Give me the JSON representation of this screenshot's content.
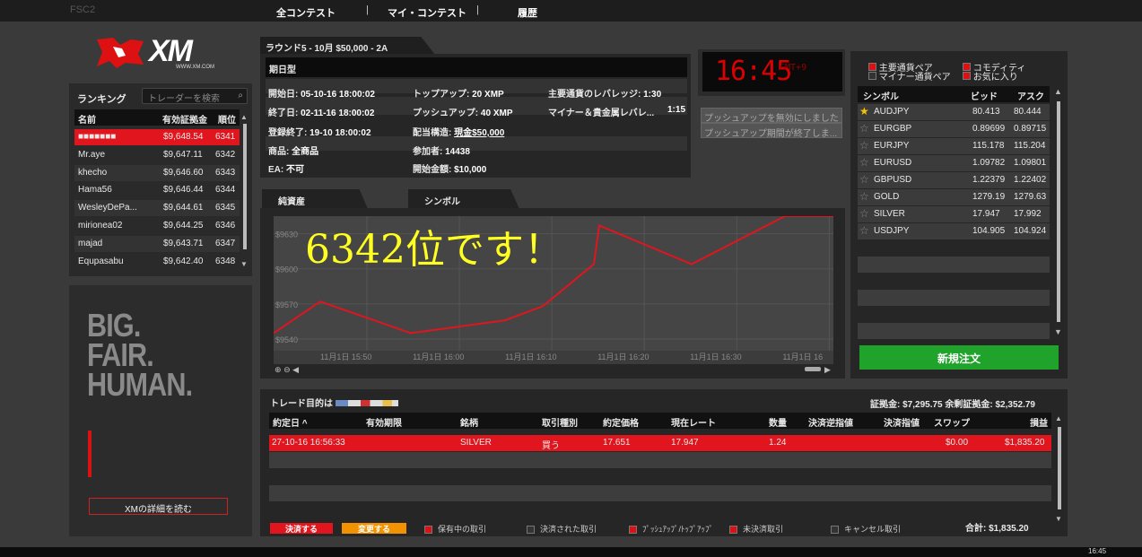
{
  "topnav": {
    "brand_faint": "FSC2",
    "all_contests": "全コンテスト",
    "sep": "|",
    "my_contests": "マイ・コンテスト",
    "history": "履歴"
  },
  "logo": {
    "text": "XM",
    "url": "WWW.XM.COM"
  },
  "ranking": {
    "title": "ランキング",
    "search_placeholder": "トレーダーを検索",
    "columns": [
      "名前",
      "有効証拠金",
      "順位"
    ],
    "rows": [
      {
        "name": "■■■■■■■",
        "equity": "$9,648.54",
        "rank": "6341"
      },
      {
        "name": "Mr.aye",
        "equity": "$9,647.11",
        "rank": "6342"
      },
      {
        "name": "khecho",
        "equity": "$9,646.60",
        "rank": "6343"
      },
      {
        "name": "Hama56",
        "equity": "$9,646.44",
        "rank": "6344"
      },
      {
        "name": "WesleyDePa...",
        "equity": "$9,644.61",
        "rank": "6345"
      },
      {
        "name": "mirionea02",
        "equity": "$9,644.25",
        "rank": "6346"
      },
      {
        "name": "majad",
        "equity": "$9,643.71",
        "rank": "6347"
      },
      {
        "name": "Equpasabu",
        "equity": "$9,642.40",
        "rank": "6348"
      }
    ]
  },
  "promo": {
    "line1": "BIG.",
    "line2": "FAIR.",
    "line3": "HUMAN.",
    "button": "XMの詳細を読む"
  },
  "round": {
    "tab": "ラウンド5 - 10月 $50,000 - 2A",
    "header": "期日型",
    "start_label": "開始日:",
    "start": "05-10-16 18:00:02",
    "end_label": "終了日:",
    "end": "02-11-16 18:00:02",
    "reg_label": "登録終了:",
    "reg": "19-10 18:00:02",
    "product_label": "商品:",
    "product": "全商品",
    "ea_label": "EA:",
    "ea": "不可",
    "topup_label": "トップアップ:",
    "topup": "20 XMP",
    "pushup_label": "プッシュアップ:",
    "pushup": "40 XMP",
    "prize_label": "配当構造:",
    "prize": "現金$50,000",
    "participants_label": "参加者:",
    "participants": "14438",
    "start_amount_label": "開始金額:",
    "start_amount": "$10,000",
    "major_lev_label": "主要通貨のレバレッジ:",
    "major_lev": "1:30",
    "minor_lev_label": "マイナー＆貴金属レバレ...",
    "minor_lev": "1:15"
  },
  "clock": {
    "time": "16:45",
    "zone": "GMT+9"
  },
  "notices": [
    "プッシュアップを無効にしました",
    "プッシュアップ期間が終了しま..."
  ],
  "chart_tabs": {
    "equity": "純資産",
    "symbol": "シンボル"
  },
  "overlay_text": "6342位です！",
  "chart_data": {
    "type": "line",
    "x": [
      "11月1日 15:45",
      "11月1日 15:50",
      "11月1日 16:00",
      "11月1日 16:05",
      "11月1日 16:10",
      "11月1日 16:15",
      "11月1日 16:18",
      "11月1日 16:25",
      "11月1日 16:30",
      "11月1日 16:38",
      "11月1日 16:45"
    ],
    "values": [
      9545,
      9572,
      9545,
      9556,
      9568,
      9604,
      9637,
      9604,
      9645,
      9645,
      9645
    ],
    "xticks": [
      "11月1日 15:50",
      "11月1日 16:00",
      "11月1日 16:10",
      "11月1日 16:20",
      "11月1日 16:30",
      "11月1日 16"
    ],
    "yticks": [
      "$9540",
      "$9570",
      "$9600",
      "$9630"
    ],
    "ylim": [
      9530,
      9645
    ],
    "color": "#e0151d"
  },
  "symbols": {
    "legend_major": "主要通貨ペア",
    "legend_minor": "マイナー通貨ペア",
    "legend_commodity": "コモディティ",
    "legend_fav": "お気に入り",
    "columns": [
      "シンボル",
      "ビッド",
      "アスク"
    ],
    "rows": [
      {
        "fav": true,
        "symbol": "AUDJPY",
        "bid": "80.413",
        "ask": "80.444"
      },
      {
        "fav": false,
        "symbol": "EURGBP",
        "bid": "0.89699",
        "ask": "0.89715"
      },
      {
        "fav": false,
        "symbol": "EURJPY",
        "bid": "115.178",
        "ask": "115.204"
      },
      {
        "fav": false,
        "symbol": "EURUSD",
        "bid": "1.09782",
        "ask": "1.09801"
      },
      {
        "fav": false,
        "symbol": "GBPUSD",
        "bid": "1.22379",
        "ask": "1.22402"
      },
      {
        "fav": false,
        "symbol": "GOLD",
        "bid": "1279.19",
        "ask": "1279.63"
      },
      {
        "fav": false,
        "symbol": "SILVER",
        "bid": "17.947",
        "ask": "17.992"
      },
      {
        "fav": false,
        "symbol": "USDJPY",
        "bid": "104.905",
        "ask": "104.924"
      }
    ],
    "new_order": "新規注文"
  },
  "trade": {
    "title": "トレード目的は",
    "margin": "証拠金: $7,295.75  余剰証拠金: $2,352.79",
    "columns": [
      "約定日 ^",
      "有効期限",
      "銘柄",
      "取引種別",
      "約定価格",
      "現在レート",
      "数量",
      "決済逆指値",
      "決済指値",
      "スワップ",
      "損益"
    ],
    "row": {
      "date": "27-10-16 16:56:33",
      "expiry": "",
      "symbol": "SILVER",
      "type": "買う",
      "price": "17.651",
      "current": "17.947",
      "qty": "1.24",
      "sl": "",
      "tp": "",
      "swap": "$0.00",
      "pl": "$1,835.20"
    },
    "close_btn": "決済する",
    "modify_btn": "変更する",
    "filters": [
      "保有中の取引",
      "決済された取引",
      "ﾌﾟｯｼｭｱｯﾌﾟ/ﾄｯﾌﾟｱｯﾌﾟ",
      "未決済取引",
      "キャンセル取引"
    ],
    "total": "合計: $1,835.20"
  },
  "taskbar_time": "16:45"
}
